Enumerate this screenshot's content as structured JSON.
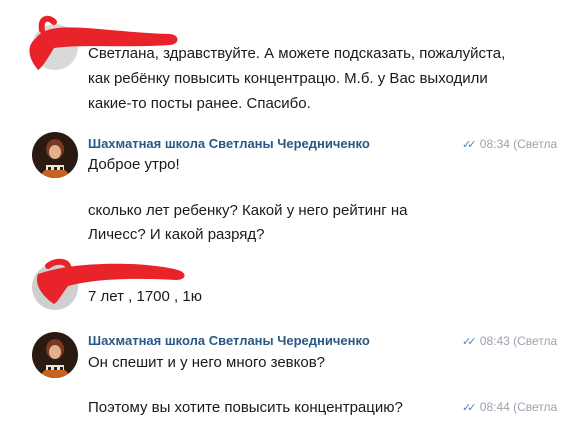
{
  "messages": [
    {
      "lines": [
        "Светлана, здравствуйте. А можете подсказать, пожалуйста,",
        "как ребёнку повысить концентрацю. М.б. у Вас выходили",
        "какие-то посты ранее. Спасибо."
      ]
    },
    {
      "sender": "Шахматная школа Светланы Чередниченко",
      "time": "08:34 (Светла",
      "lines": [
        "Доброе утро!",
        "",
        "сколько лет ребенку? Какой у него рейтинг на",
        "Личесс? И какой разряд?"
      ]
    },
    {
      "lines": [
        "7 лет , 1700 , 1ю"
      ]
    },
    {
      "sender": "Шахматная школа Светланы Чередниченко",
      "time": "08:43 (Светла",
      "lines": [
        "Он спешит и у него много зевков?"
      ]
    },
    {
      "time": "08:44 (Светла",
      "lines": [
        "Поэтому вы хотите повысить концентрацию?"
      ]
    }
  ],
  "colors": {
    "sender": "#2a5885",
    "meta": "#9aa3ad",
    "check": "#5181b8",
    "redaction": "#e8242a"
  },
  "icons": {
    "read_receipt": "double-check-icon",
    "avatar": "chess-school-avatar"
  }
}
